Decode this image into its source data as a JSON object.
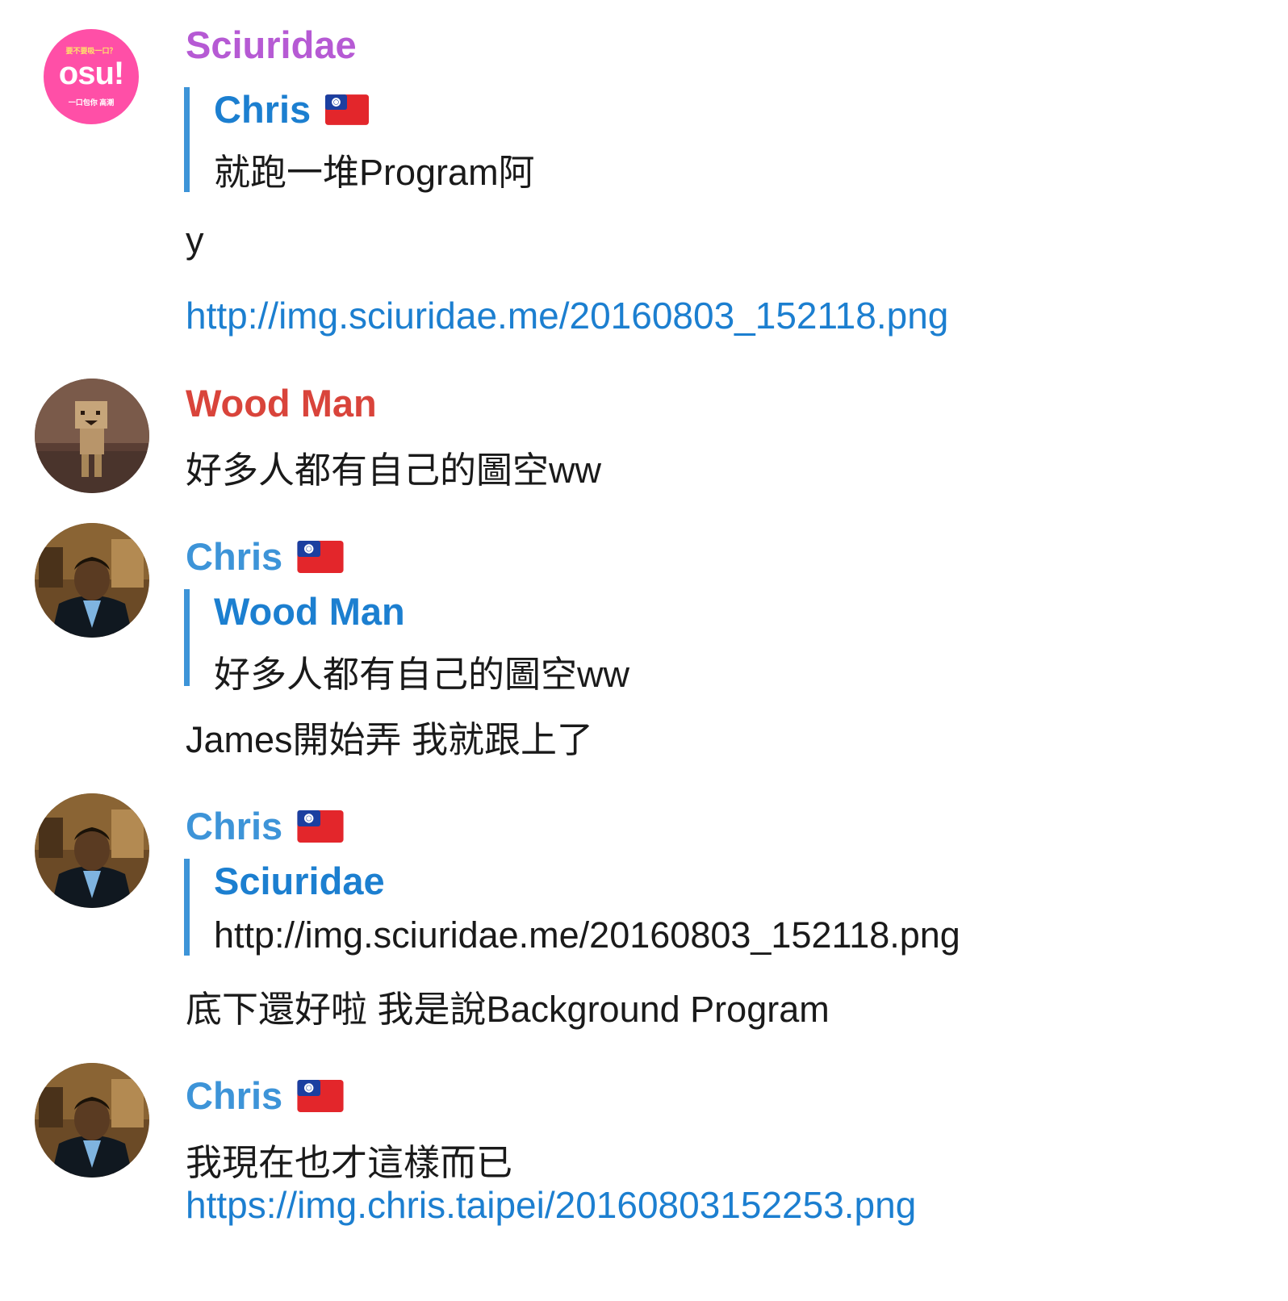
{
  "colors": {
    "sciuridae_name": "#b65ad4",
    "woodman_name": "#d9443b",
    "chris_name": "#3d94d8",
    "quote_bar": "#3d94d8",
    "link": "#1c7fd0",
    "osu_avatar_bg": "#ff4fa7"
  },
  "messages": [
    {
      "sender": "Sciuridae",
      "avatar_text": "osu!",
      "avatar_top_text": "要不要吸一口？",
      "avatar_bottom_text": "一口包你 高潮",
      "quote": {
        "author": "Chris",
        "flag": "taiwan-flag-icon",
        "text": "就跑一堆Program阿"
      },
      "lines": [
        "y"
      ],
      "link": "http://img.sciuridae.me/20160803_152118.png"
    },
    {
      "sender": "Wood Man",
      "lines": [
        "好多人都有自己的圖空ww"
      ]
    },
    {
      "sender": "Chris",
      "flag": "taiwan-flag-icon",
      "quote": {
        "author": "Wood Man",
        "text": "好多人都有自己的圖空ww"
      },
      "lines": [
        "James開始弄 我就跟上了"
      ]
    },
    {
      "sender": "Chris",
      "flag": "taiwan-flag-icon",
      "quote": {
        "author": "Sciuridae",
        "text": "http://img.sciuridae.me/20160803_152118.png"
      },
      "lines": [
        "底下還好啦 我是說Background Program"
      ]
    },
    {
      "sender": "Chris",
      "flag": "taiwan-flag-icon",
      "lines": [
        "我現在也才這樣而已"
      ],
      "link": "https://img.chris.taipei/20160803152253.png"
    }
  ]
}
